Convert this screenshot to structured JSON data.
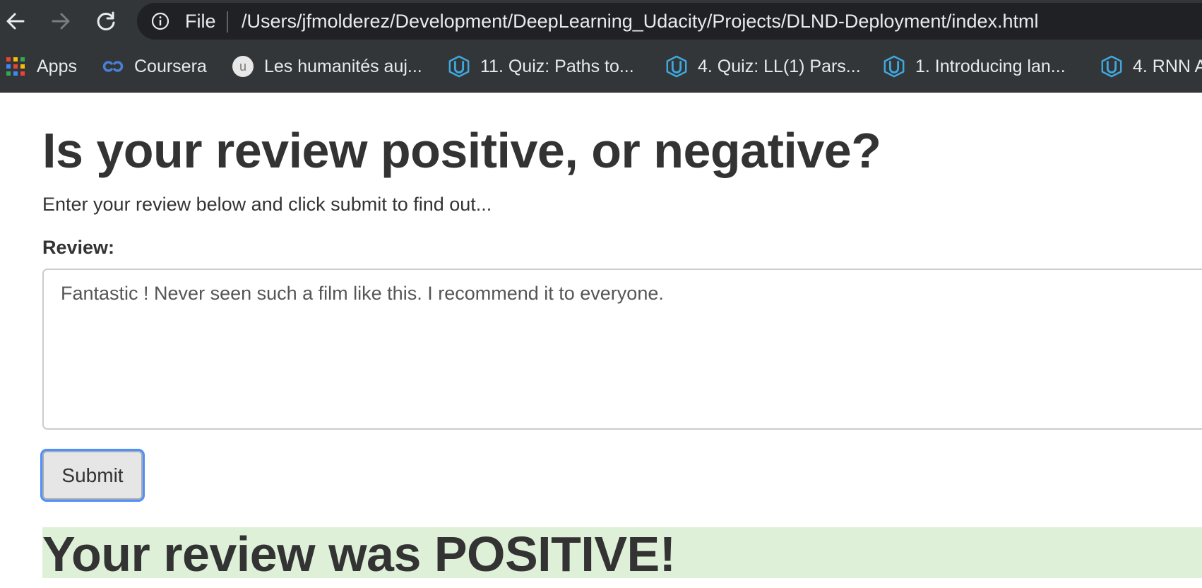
{
  "browser": {
    "address_bar": {
      "scheme_label": "File",
      "url": "/Users/jfmolderez/Development/DeepLearning_Udacity/Projects/DLND-Deployment/index.html"
    },
    "bookmarks": [
      {
        "label": "Apps",
        "icon": "apps-grid-icon"
      },
      {
        "label": "Coursera",
        "icon": "coursera-icon"
      },
      {
        "label": "Les humanités auj...",
        "icon": "udemy-u-icon"
      },
      {
        "label": "11. Quiz: Paths to...",
        "icon": "udacity-icon"
      },
      {
        "label": "4. Quiz: LL(1) Pars...",
        "icon": "udacity-icon"
      },
      {
        "label": "1. Introducing lan...",
        "icon": "udacity-icon"
      },
      {
        "label": "4. RNN A",
        "icon": "udacity-icon"
      }
    ]
  },
  "page": {
    "title": "Is your review positive, or negative?",
    "lead": "Enter your review below and click submit to find out...",
    "review_label": "Review:",
    "review_text": "Fantastic ! Never seen such a film like this. I recommend it to everyone.",
    "submit_label": "Submit",
    "result_text": "Your review was POSITIVE!"
  },
  "colors": {
    "toolbar_bg": "#323639",
    "omnibox_bg": "#202124",
    "result_bg": "#dff0d8",
    "focus_ring": "#4d90fe",
    "udacity_icon": "#3fa9df"
  }
}
